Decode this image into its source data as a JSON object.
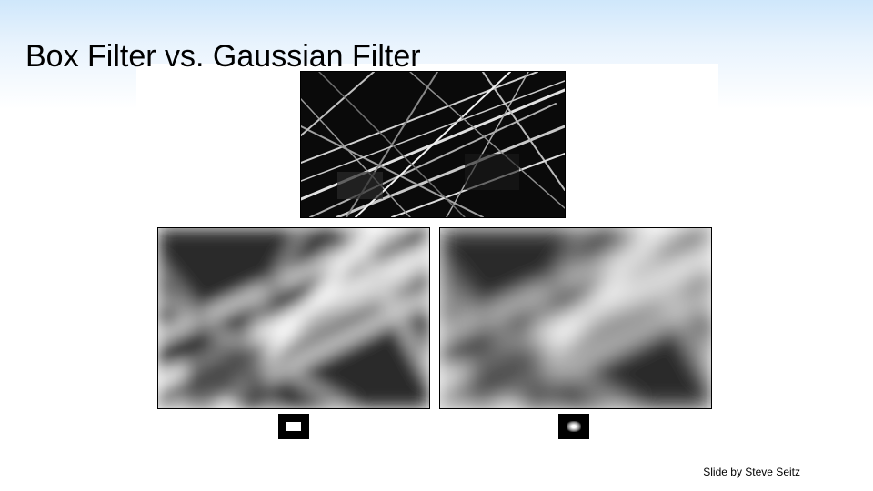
{
  "title": "Box Filter vs. Gaussian Filter",
  "attribution": "Slide by Steve Seitz",
  "images": {
    "original_alt": "original-grass-image",
    "box_filtered_alt": "box-filtered-image",
    "gaussian_filtered_alt": "gaussian-filtered-image"
  },
  "kernels": {
    "box_label": "box-kernel",
    "gaussian_label": "gaussian-kernel"
  }
}
